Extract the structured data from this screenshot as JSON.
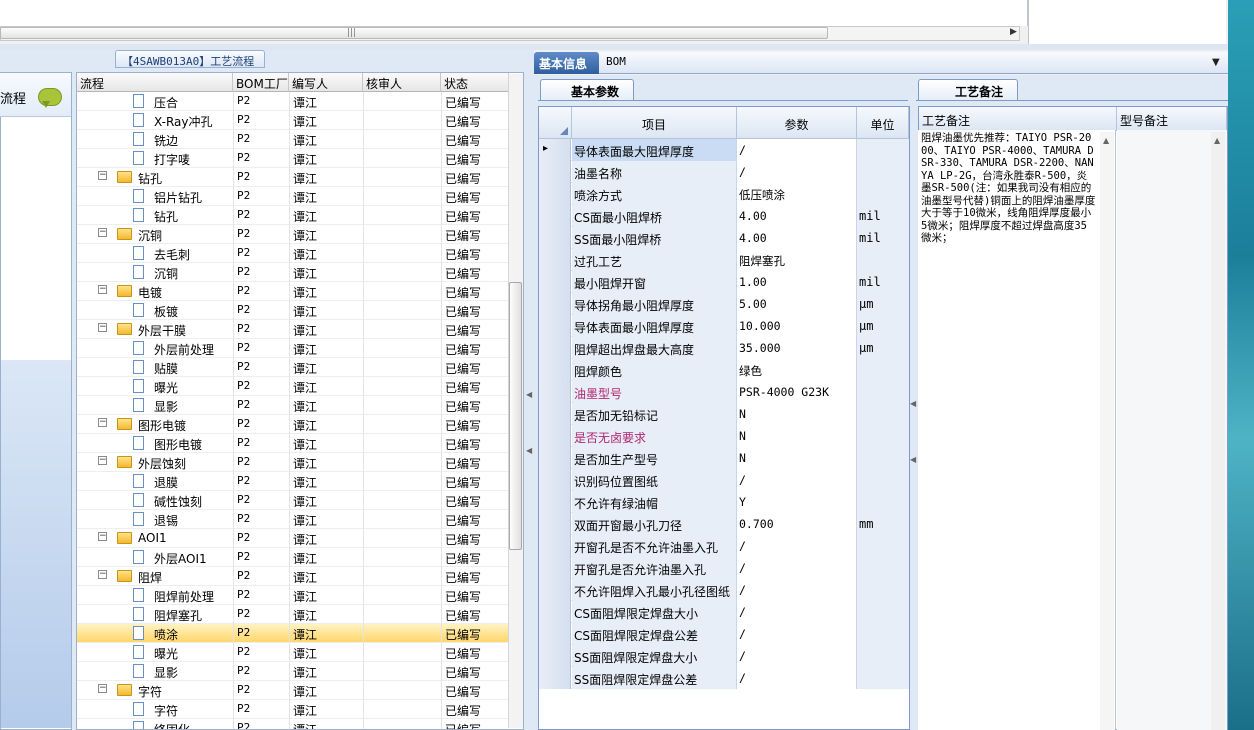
{
  "left_panel": {
    "tab_title": "【4SAWB013A0】工艺流程",
    "side_label": "流程",
    "columns": [
      "流程",
      "BOM工厂",
      "编写人",
      "核审人",
      "状态"
    ],
    "rows": [
      {
        "name": "压合",
        "level": 2,
        "factory": "P2",
        "writer": "谭江",
        "status": "已编写"
      },
      {
        "name": "X-Ray冲孔",
        "level": 2,
        "factory": "P2",
        "writer": "谭江",
        "status": "已编写"
      },
      {
        "name": "铣边",
        "level": 2,
        "factory": "P2",
        "writer": "谭江",
        "status": "已编写"
      },
      {
        "name": "打字唛",
        "level": 2,
        "factory": "P2",
        "writer": "谭江",
        "status": "已编写"
      },
      {
        "name": "钻孔",
        "level": 1,
        "factory": "P2",
        "writer": "谭江",
        "status": "已编写"
      },
      {
        "name": "铝片钻孔",
        "level": 2,
        "factory": "P2",
        "writer": "谭江",
        "status": "已编写"
      },
      {
        "name": "钻孔",
        "level": 2,
        "factory": "P2",
        "writer": "谭江",
        "status": "已编写"
      },
      {
        "name": "沉铜",
        "level": 1,
        "factory": "P2",
        "writer": "谭江",
        "status": "已编写"
      },
      {
        "name": "去毛刺",
        "level": 2,
        "factory": "P2",
        "writer": "谭江",
        "status": "已编写"
      },
      {
        "name": "沉铜",
        "level": 2,
        "factory": "P2",
        "writer": "谭江",
        "status": "已编写"
      },
      {
        "name": "电镀",
        "level": 1,
        "factory": "P2",
        "writer": "谭江",
        "status": "已编写"
      },
      {
        "name": "板镀",
        "level": 2,
        "factory": "P2",
        "writer": "谭江",
        "status": "已编写"
      },
      {
        "name": "外层干膜",
        "level": 1,
        "factory": "P2",
        "writer": "谭江",
        "status": "已编写"
      },
      {
        "name": "外层前处理",
        "level": 2,
        "factory": "P2",
        "writer": "谭江",
        "status": "已编写"
      },
      {
        "name": "贴膜",
        "level": 2,
        "factory": "P2",
        "writer": "谭江",
        "status": "已编写"
      },
      {
        "name": "曝光",
        "level": 2,
        "factory": "P2",
        "writer": "谭江",
        "status": "已编写"
      },
      {
        "name": "显影",
        "level": 2,
        "factory": "P2",
        "writer": "谭江",
        "status": "已编写"
      },
      {
        "name": "图形电镀",
        "level": 1,
        "factory": "P2",
        "writer": "谭江",
        "status": "已编写"
      },
      {
        "name": "图形电镀",
        "level": 2,
        "factory": "P2",
        "writer": "谭江",
        "status": "已编写"
      },
      {
        "name": "外层蚀刻",
        "level": 1,
        "factory": "P2",
        "writer": "谭江",
        "status": "已编写"
      },
      {
        "name": "退膜",
        "level": 2,
        "factory": "P2",
        "writer": "谭江",
        "status": "已编写"
      },
      {
        "name": "碱性蚀刻",
        "level": 2,
        "factory": "P2",
        "writer": "谭江",
        "status": "已编写"
      },
      {
        "name": "退锡",
        "level": 2,
        "factory": "P2",
        "writer": "谭江",
        "status": "已编写"
      },
      {
        "name": "AOI1",
        "level": 1,
        "factory": "P2",
        "writer": "谭江",
        "status": "已编写"
      },
      {
        "name": "外层AOI1",
        "level": 2,
        "factory": "P2",
        "writer": "谭江",
        "status": "已编写"
      },
      {
        "name": "阻焊",
        "level": 1,
        "factory": "P2",
        "writer": "谭江",
        "status": "已编写"
      },
      {
        "name": "阻焊前处理",
        "level": 2,
        "factory": "P2",
        "writer": "谭江",
        "status": "已编写"
      },
      {
        "name": "阻焊塞孔",
        "level": 2,
        "factory": "P2",
        "writer": "谭江",
        "status": "已编写"
      },
      {
        "name": "喷涂",
        "level": 2,
        "factory": "P2",
        "writer": "谭江",
        "status": "已编写",
        "selected": true
      },
      {
        "name": "曝光",
        "level": 2,
        "factory": "P2",
        "writer": "谭江",
        "status": "已编写"
      },
      {
        "name": "显影",
        "level": 2,
        "factory": "P2",
        "writer": "谭江",
        "status": "已编写"
      },
      {
        "name": "字符",
        "level": 1,
        "factory": "P2",
        "writer": "谭江",
        "status": "已编写"
      },
      {
        "name": "字符",
        "level": 2,
        "factory": "P2",
        "writer": "谭江",
        "status": "已编写"
      },
      {
        "name": "终固化",
        "level": 2,
        "factory": "P2",
        "writer": "谭江",
        "status": "已编写"
      }
    ]
  },
  "right_panel": {
    "tabs": [
      {
        "label": "基本信息",
        "active": true
      },
      {
        "label": "BOM",
        "active": false
      }
    ],
    "sub_tab": "基本参数",
    "param_columns": [
      "项目",
      "参数",
      "单位"
    ],
    "params": [
      {
        "item": "导体表面最大阻焊厚度",
        "value": "/",
        "unit": "",
        "highlight": false
      },
      {
        "item": "油墨名称",
        "value": "/",
        "unit": "",
        "highlight": false
      },
      {
        "item": "喷涂方式",
        "value": "低压喷涂",
        "unit": "",
        "highlight": false
      },
      {
        "item": "CS面最小阻焊桥",
        "value": "4.00",
        "unit": "mil",
        "highlight": false
      },
      {
        "item": "SS面最小阻焊桥",
        "value": "4.00",
        "unit": "mil",
        "highlight": false
      },
      {
        "item": "过孔工艺",
        "value": "阻焊塞孔",
        "unit": "",
        "highlight": false
      },
      {
        "item": "最小阻焊开窗",
        "value": "1.00",
        "unit": "mil",
        "highlight": false
      },
      {
        "item": "导体拐角最小阻焊厚度",
        "value": "5.00",
        "unit": "μm",
        "highlight": false
      },
      {
        "item": "导体表面最小阻焊厚度",
        "value": "10.000",
        "unit": "μm",
        "highlight": false
      },
      {
        "item": "阻焊超出焊盘最大高度",
        "value": "35.000",
        "unit": "μm",
        "highlight": false
      },
      {
        "item": "阻焊颜色",
        "value": "绿色",
        "unit": "",
        "highlight": false
      },
      {
        "item": "油墨型号",
        "value": "PSR-4000 G23K",
        "unit": "",
        "highlight": true
      },
      {
        "item": "是否加无铅标记",
        "value": "N",
        "unit": "",
        "highlight": false
      },
      {
        "item": "是否无卤要求",
        "value": "N",
        "unit": "",
        "highlight": true
      },
      {
        "item": "是否加生产型号",
        "value": "N",
        "unit": "",
        "highlight": false
      },
      {
        "item": "识别码位置图纸",
        "value": "/",
        "unit": "",
        "highlight": false
      },
      {
        "item": "不允许有绿油帽",
        "value": "Y",
        "unit": "",
        "highlight": false
      },
      {
        "item": "双面开窗最小孔刀径",
        "value": "0.700",
        "unit": "mm",
        "highlight": false
      },
      {
        "item": "开窗孔是否不允许油墨入孔",
        "value": "/",
        "unit": "",
        "highlight": false
      },
      {
        "item": "开窗孔是否允许油墨入孔",
        "value": "/",
        "unit": "",
        "highlight": false
      },
      {
        "item": "不允许阻焊入孔最小孔径图纸",
        "value": "/",
        "unit": "",
        "highlight": false
      },
      {
        "item": "CS面阻焊限定焊盘大小",
        "value": "/",
        "unit": "",
        "highlight": false
      },
      {
        "item": "CS面阻焊限定焊盘公差",
        "value": "/",
        "unit": "",
        "highlight": false
      },
      {
        "item": "SS面阻焊限定焊盘大小",
        "value": "/",
        "unit": "",
        "highlight": false
      },
      {
        "item": "SS面阻焊限定焊盘公差",
        "value": "/",
        "unit": "",
        "highlight": false
      }
    ],
    "notes_tab": "工艺备注",
    "notes_columns": [
      "工艺备注",
      "型号备注"
    ],
    "process_note": "阻焊油墨优先推荐：TAIYO PSR-2000、TAIYO PSR-4000、TAMURA DSR-330、TAMURA DSR-2200、NANYA LP-2G，台湾永胜泰R-500，炎墨SR-500(注：如果我司没有相应的油墨型号代替)铜面上的阻焊油墨厚度大于等于10微米，线角阻焊厚度最小5微米；阻焊厚度不超过焊盘高度35微米；",
    "model_note": ""
  },
  "colors": {
    "accent": "#2f5e9e",
    "selected_row": "#ffd66b",
    "highlight_text": "#b0266e"
  }
}
